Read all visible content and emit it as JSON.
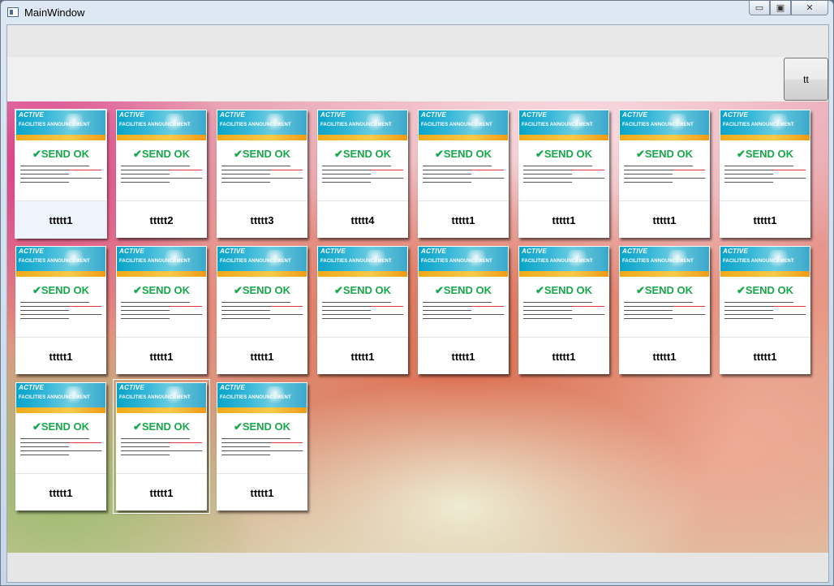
{
  "window": {
    "title": "MainWindow",
    "buttons": {
      "minimize": "▭",
      "maximize": "▣",
      "close": "✕"
    }
  },
  "toolbar": {
    "tt_label": "tt"
  },
  "card_common": {
    "logo": "ACTIVE",
    "banner_title": "FACILITIES ANNOUNCEMENT",
    "status": "✔SEND OK"
  },
  "cards": [
    {
      "label": "ttttt1",
      "selected": true
    },
    {
      "label": "ttttt2"
    },
    {
      "label": "ttttt3"
    },
    {
      "label": "ttttt4"
    },
    {
      "label": "ttttt1"
    },
    {
      "label": "ttttt1"
    },
    {
      "label": "ttttt1"
    },
    {
      "label": "ttttt1"
    },
    {
      "label": "ttttt1"
    },
    {
      "label": "ttttt1"
    },
    {
      "label": "ttttt1"
    },
    {
      "label": "ttttt1"
    },
    {
      "label": "ttttt1"
    },
    {
      "label": "ttttt1"
    },
    {
      "label": "ttttt1"
    },
    {
      "label": "ttttt1"
    },
    {
      "label": "ttttt1"
    },
    {
      "label": "ttttt1",
      "highlight": true
    },
    {
      "label": "ttttt1"
    }
  ],
  "colors": {
    "status_green": "#17a84b",
    "banner_blue": "#0aa3c9",
    "banner_orange": "#f0a91a"
  }
}
